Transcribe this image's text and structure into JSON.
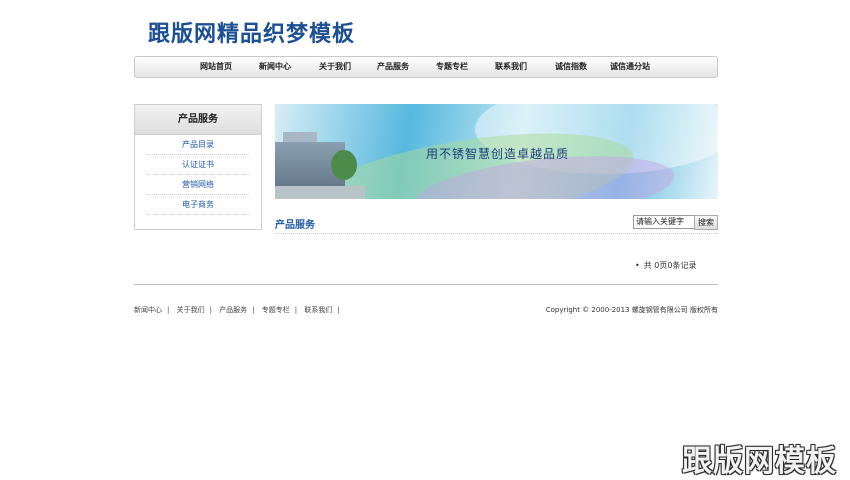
{
  "logo": "跟版网精品织梦模板",
  "nav": [
    "网站首页",
    "新闻中心",
    "关于我们",
    "产品服务",
    "专题专栏",
    "联系我们",
    "诚信指数",
    "诚信通分站"
  ],
  "sidebar": {
    "title": "产品服务",
    "items": [
      "产品目录",
      "认证证书",
      "营销网络",
      "电子商务"
    ]
  },
  "banner": {
    "slogan": "用不锈智慧创造卓越品质"
  },
  "section": {
    "title": "产品服务"
  },
  "search": {
    "value": "请输入关键字",
    "button": "搜索"
  },
  "pager": {
    "text": "共 0页0条记录"
  },
  "footer": {
    "links": [
      "新闻中心",
      "关于我们",
      "产品服务",
      "专题专栏",
      "联系我们"
    ],
    "separator": "|",
    "copyright": "Copyright © 2000-2013 螺旋钢管有限公司 版权所有"
  },
  "watermark": "跟版网模板"
}
